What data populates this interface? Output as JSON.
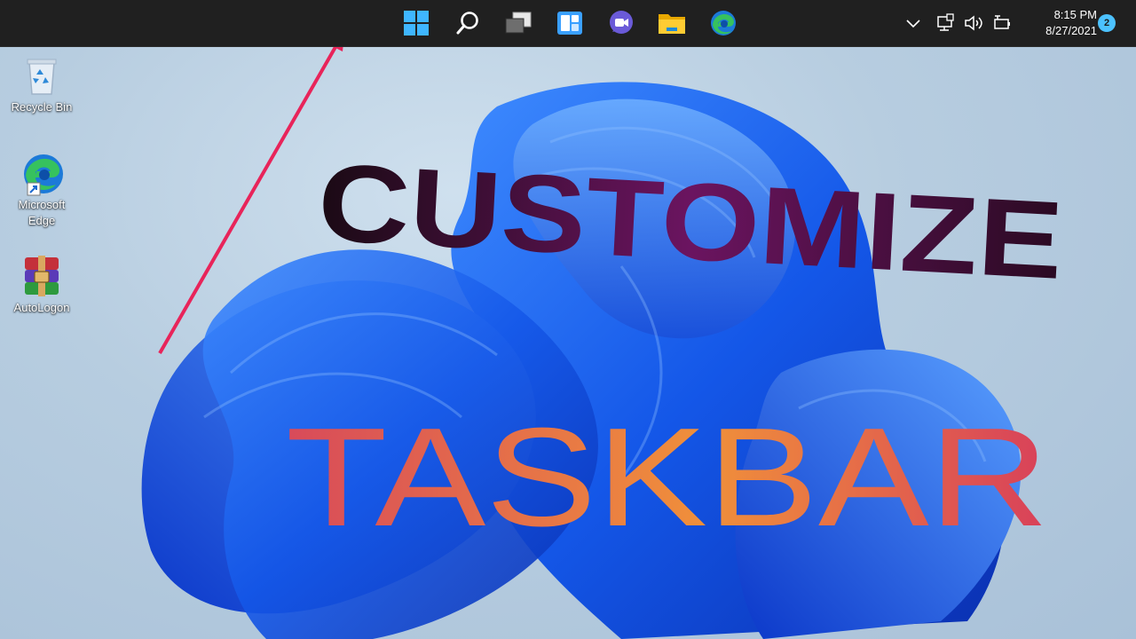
{
  "taskbar": {
    "apps": [
      {
        "name": "Start",
        "icon": "windows-start-icon"
      },
      {
        "name": "Search",
        "icon": "search-icon"
      },
      {
        "name": "Task View",
        "icon": "task-view-icon"
      },
      {
        "name": "Widgets",
        "icon": "widgets-icon"
      },
      {
        "name": "Chat",
        "icon": "chat-icon"
      },
      {
        "name": "File Explorer",
        "icon": "folder-icon"
      },
      {
        "name": "Microsoft Edge",
        "icon": "edge-icon"
      }
    ],
    "tray": {
      "time": "8:15 PM",
      "date": "8/27/2021",
      "notification_count": "2"
    }
  },
  "desktop": {
    "icons": [
      {
        "label": "Recycle Bin",
        "icon": "recycle-bin-icon"
      },
      {
        "label": "Microsoft Edge",
        "icon": "edge-icon"
      },
      {
        "label": "AutoLogon",
        "icon": "winrar-archive-icon"
      }
    ]
  },
  "overlay": {
    "line1": "CUSTOMIZE",
    "line2": "TASKBAR"
  },
  "colors": {
    "taskbar_bg": "#202020",
    "accent": "#4cc2ff",
    "arrow": "#e8245a",
    "wallpaper_blue": "#1a5cf0"
  }
}
